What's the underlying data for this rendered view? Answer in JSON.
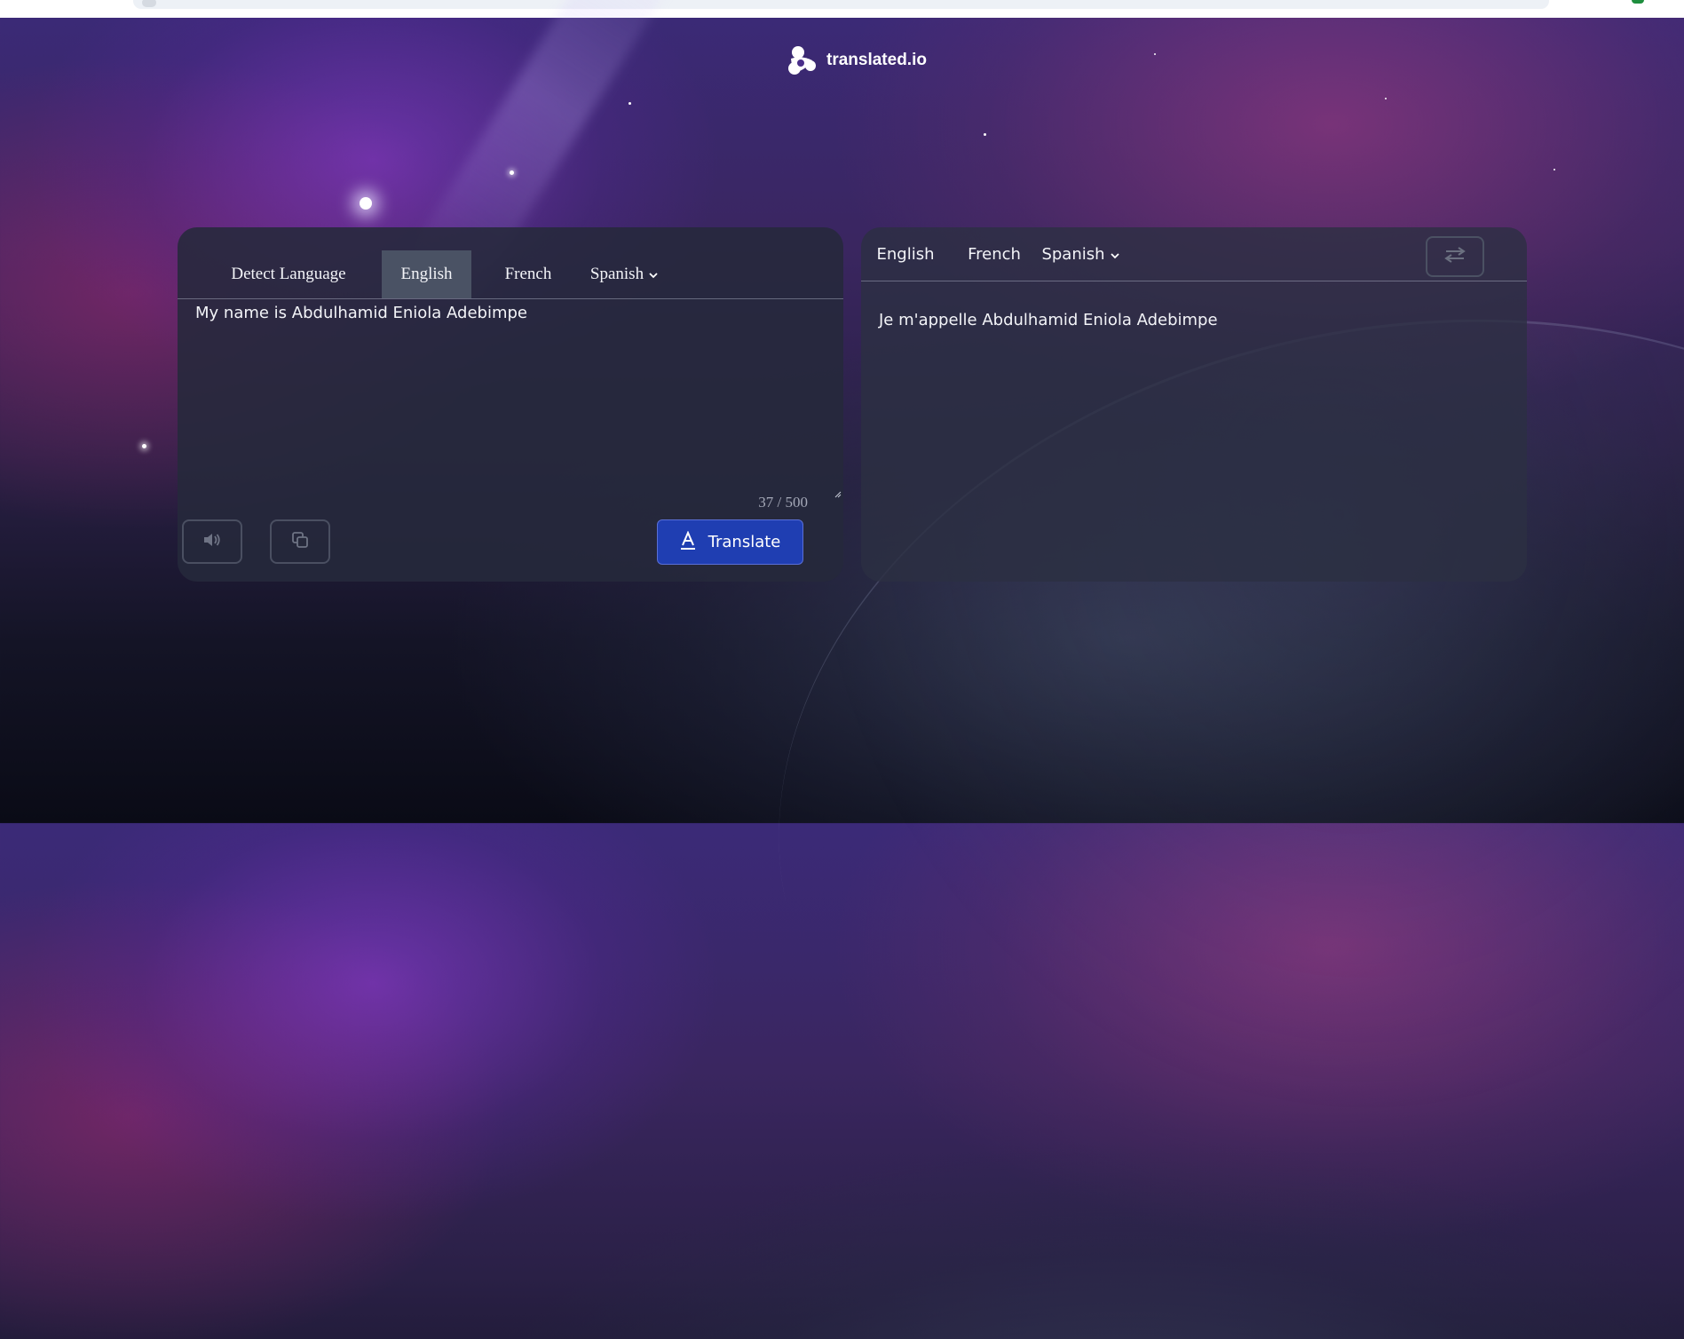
{
  "app": {
    "brand_name": "translated.io"
  },
  "source_panel": {
    "tabs": [
      {
        "label": "Detect Language",
        "active": false
      },
      {
        "label": "English",
        "active": true
      },
      {
        "label": "French",
        "active": false
      },
      {
        "label": "Spanish",
        "active": false,
        "dropdown": true
      }
    ],
    "input_value": "My name is Abdulhamid Eniola Adebimpe",
    "char_count": {
      "current": "37",
      "separator": " / ",
      "max": "500"
    },
    "buttons": {
      "speak_icon": "speaker-icon",
      "copy_icon": "copy-icon",
      "translate_label": "Translate",
      "translate_icon": "translate-icon"
    }
  },
  "target_panel": {
    "tabs": [
      {
        "label": "English",
        "active": false
      },
      {
        "label": "French",
        "active": false
      },
      {
        "label": "Spanish",
        "active": false,
        "dropdown": true
      }
    ],
    "swap_icon": "swap-icon",
    "output_text": "Je m'appelle Abdulhamid Eniola Adebimpe"
  },
  "colors": {
    "panel_bg": "#26293b",
    "active_tab": "#4a5264",
    "translate_button": "#1f3eb2",
    "muted_text": "#a5a9b8"
  }
}
